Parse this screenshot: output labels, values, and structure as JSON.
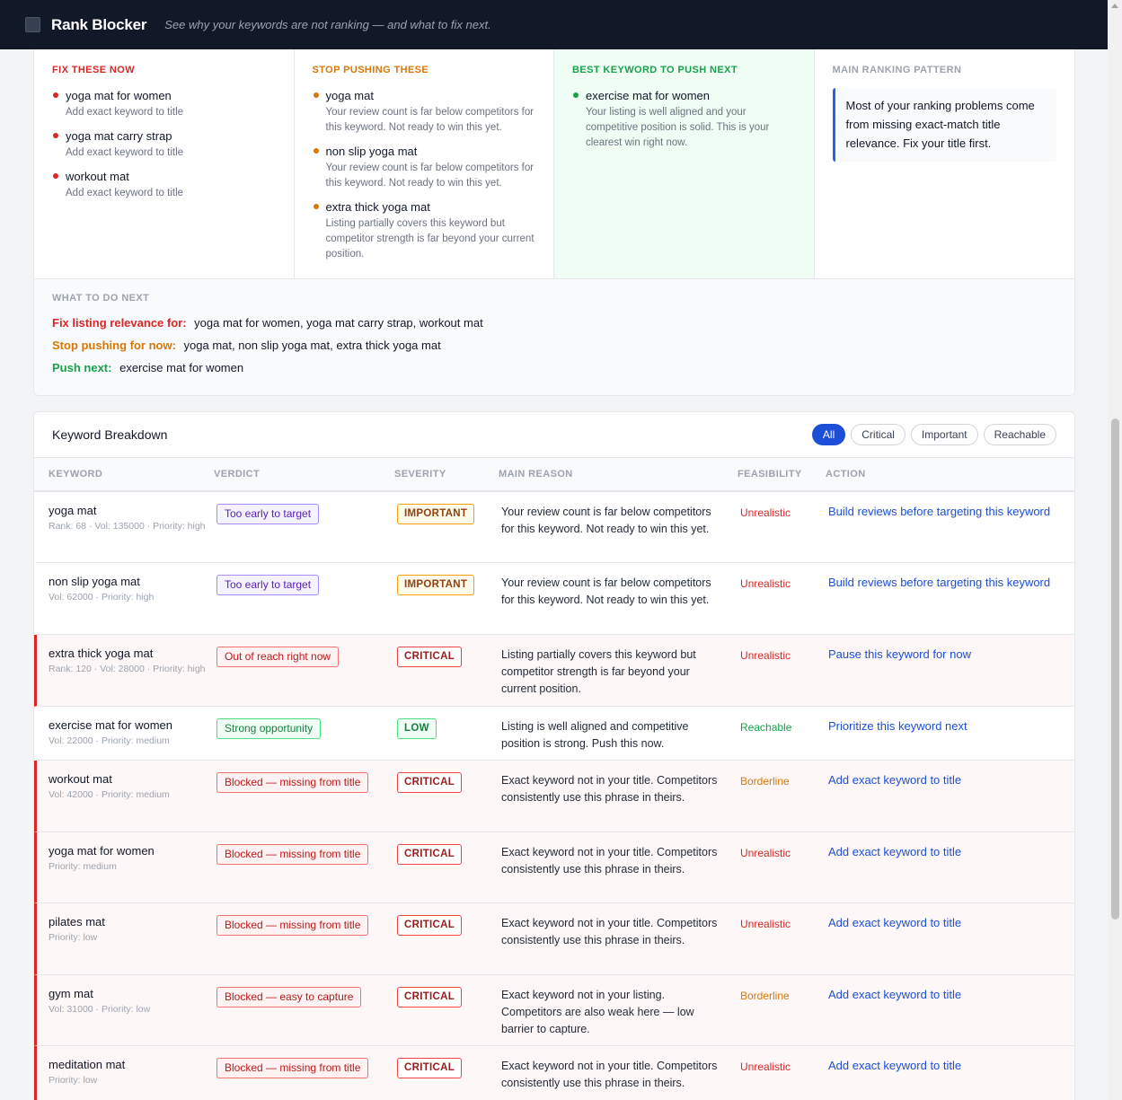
{
  "header": {
    "title": "Rank Blocker",
    "tagline": "See why your keywords are not ranking — and what to fix next."
  },
  "summary": {
    "fix": {
      "heading": "FIX THESE NOW",
      "items": [
        {
          "title": "yoga mat for women",
          "sub": "Add exact keyword to title"
        },
        {
          "title": "yoga mat carry strap",
          "sub": "Add exact keyword to title"
        },
        {
          "title": "workout mat",
          "sub": "Add exact keyword to title"
        }
      ]
    },
    "stop": {
      "heading": "STOP PUSHING THESE",
      "items": [
        {
          "title": "yoga mat",
          "sub": "Your review count is far below competitors for this keyword. Not ready to win this yet."
        },
        {
          "title": "non slip yoga mat",
          "sub": "Your review count is far below competitors for this keyword. Not ready to win this yet."
        },
        {
          "title": "extra thick yoga mat",
          "sub": "Listing partially covers this keyword but competitor strength is far beyond your current position."
        }
      ]
    },
    "best": {
      "heading": "BEST KEYWORD TO PUSH NEXT",
      "items": [
        {
          "title": "exercise mat for women",
          "sub": "Your listing is well aligned and your competitive position is solid. This is your clearest win right now."
        }
      ]
    },
    "pattern": {
      "heading": "MAIN RANKING PATTERN",
      "text": "Most of your ranking problems come from missing exact-match title relevance. Fix your title first."
    },
    "next": {
      "heading": "WHAT TO DO NEXT",
      "fix_label": "Fix listing relevance for:",
      "fix_value": "yoga mat for women, yoga mat carry strap, workout mat",
      "stop_label": "Stop pushing for now:",
      "stop_value": "yoga mat, non slip yoga mat, extra thick yoga mat",
      "push_label": "Push next:",
      "push_value": "exercise mat for women"
    }
  },
  "breakdown": {
    "title": "Keyword Breakdown",
    "filters": [
      "All",
      "Critical",
      "Important",
      "Reachable"
    ],
    "active_filter": "All",
    "columns": [
      "KEYWORD",
      "VERDICT",
      "SEVERITY",
      "MAIN REASON",
      "FEASIBILITY",
      "ACTION"
    ],
    "rows": [
      {
        "keyword": "yoga mat",
        "meta": "Rank: 68 · Vol: 135000 · Priority: high",
        "verdict": "Too early to target",
        "verdict_style": "purple",
        "severity": "IMPORTANT",
        "severity_style": "imp",
        "reason": "Your review count is far below competitors for this keyword. Not ready to win this yet.",
        "feasibility": "Unrealistic",
        "feasibility_style": "unreal",
        "action": "Build reviews before targeting this keyword",
        "critical": false
      },
      {
        "keyword": "non slip yoga mat",
        "meta": "Vol: 62000 · Priority: high",
        "verdict": "Too early to target",
        "verdict_style": "purple",
        "severity": "IMPORTANT",
        "severity_style": "imp",
        "reason": "Your review count is far below competitors for this keyword. Not ready to win this yet.",
        "feasibility": "Unrealistic",
        "feasibility_style": "unreal",
        "action": "Build reviews before targeting this keyword",
        "critical": false
      },
      {
        "keyword": "extra thick yoga mat",
        "meta": "Rank: 120 · Vol: 28000 · Priority: high",
        "verdict": "Out of reach right now",
        "verdict_style": "red",
        "severity": "CRITICAL",
        "severity_style": "crit",
        "reason": "Listing partially covers this keyword but competitor strength is far beyond your current position.",
        "feasibility": "Unrealistic",
        "feasibility_style": "unreal",
        "action": "Pause this keyword for now",
        "critical": true
      },
      {
        "keyword": "exercise mat for women",
        "meta": "Vol: 22000 · Priority: medium",
        "verdict": "Strong opportunity",
        "verdict_style": "green",
        "severity": "LOW",
        "severity_style": "low",
        "reason": "Listing is well aligned and competitive position is strong. Push this now.",
        "feasibility": "Reachable",
        "feasibility_style": "reach",
        "action": "Prioritize this keyword next",
        "critical": false
      },
      {
        "keyword": "workout mat",
        "meta": "Vol: 42000 · Priority: medium",
        "verdict": "Blocked — missing from title",
        "verdict_style": "red",
        "severity": "CRITICAL",
        "severity_style": "crit",
        "reason": "Exact keyword not in your title. Competitors consistently use this phrase in theirs.",
        "feasibility": "Borderline",
        "feasibility_style": "border",
        "action": "Add exact keyword to title",
        "critical": true
      },
      {
        "keyword": "yoga mat for women",
        "meta": "Priority: medium",
        "verdict": "Blocked — missing from title",
        "verdict_style": "red",
        "severity": "CRITICAL",
        "severity_style": "crit",
        "reason": "Exact keyword not in your title. Competitors consistently use this phrase in theirs.",
        "feasibility": "Unrealistic",
        "feasibility_style": "unreal",
        "action": "Add exact keyword to title",
        "critical": true
      },
      {
        "keyword": "pilates mat",
        "meta": "Priority: low",
        "verdict": "Blocked — missing from title",
        "verdict_style": "red",
        "severity": "CRITICAL",
        "severity_style": "crit",
        "reason": "Exact keyword not in your title. Competitors consistently use this phrase in theirs.",
        "feasibility": "Unrealistic",
        "feasibility_style": "unreal",
        "action": "Add exact keyword to title",
        "critical": true
      },
      {
        "keyword": "gym mat",
        "meta": "Vol: 31000 · Priority: low",
        "verdict": "Blocked — easy to capture",
        "verdict_style": "red",
        "severity": "CRITICAL",
        "severity_style": "crit",
        "reason": "Exact keyword not in your listing. Competitors are also weak here — low barrier to capture.",
        "feasibility": "Borderline",
        "feasibility_style": "border",
        "action": "Add exact keyword to title",
        "critical": true
      },
      {
        "keyword": "meditation mat",
        "meta": "Priority: low",
        "verdict": "Blocked — missing from title",
        "verdict_style": "red",
        "severity": "CRITICAL",
        "severity_style": "crit",
        "reason": "Exact keyword not in your title. Competitors consistently use this phrase in theirs.",
        "feasibility": "Unrealistic",
        "feasibility_style": "unreal",
        "action": "Add exact keyword to title",
        "critical": true
      }
    ]
  }
}
